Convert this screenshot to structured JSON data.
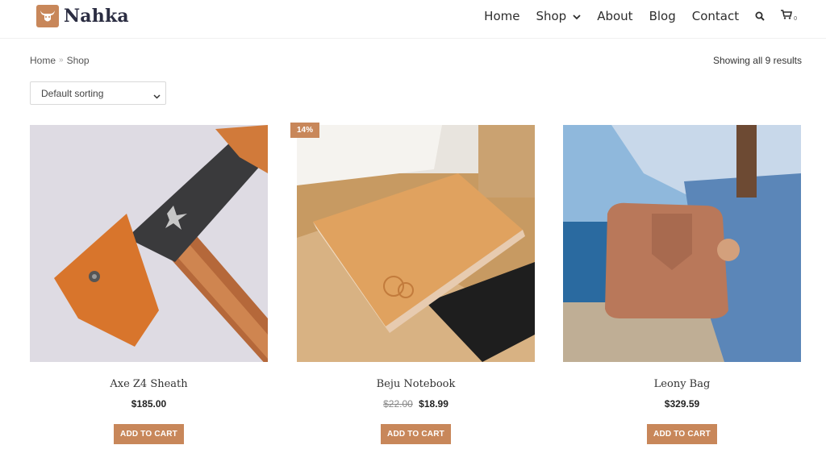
{
  "brand": {
    "name": "Nahka",
    "accent": "#c8875a"
  },
  "nav": {
    "items": [
      {
        "label": "Home"
      },
      {
        "label": "Shop"
      },
      {
        "label": "About"
      },
      {
        "label": "Blog"
      },
      {
        "label": "Contact"
      }
    ],
    "cart_count": "0"
  },
  "breadcrumb": {
    "home": "Home",
    "separator": "»",
    "current": "Shop"
  },
  "results_text": "Showing all 9 results",
  "sorting": {
    "selected": "Default sorting"
  },
  "products": [
    {
      "name": "Axe Z4 Sheath",
      "price": "$185.00",
      "old_price": "",
      "badge": "",
      "button": "ADD TO CART"
    },
    {
      "name": "Beju Notebook",
      "price": "$18.99",
      "old_price": "$22.00",
      "badge": "14%",
      "button": "ADD TO CART"
    },
    {
      "name": "Leony Bag",
      "price": "$329.59",
      "old_price": "",
      "badge": "",
      "button": "ADD TO CART"
    }
  ]
}
